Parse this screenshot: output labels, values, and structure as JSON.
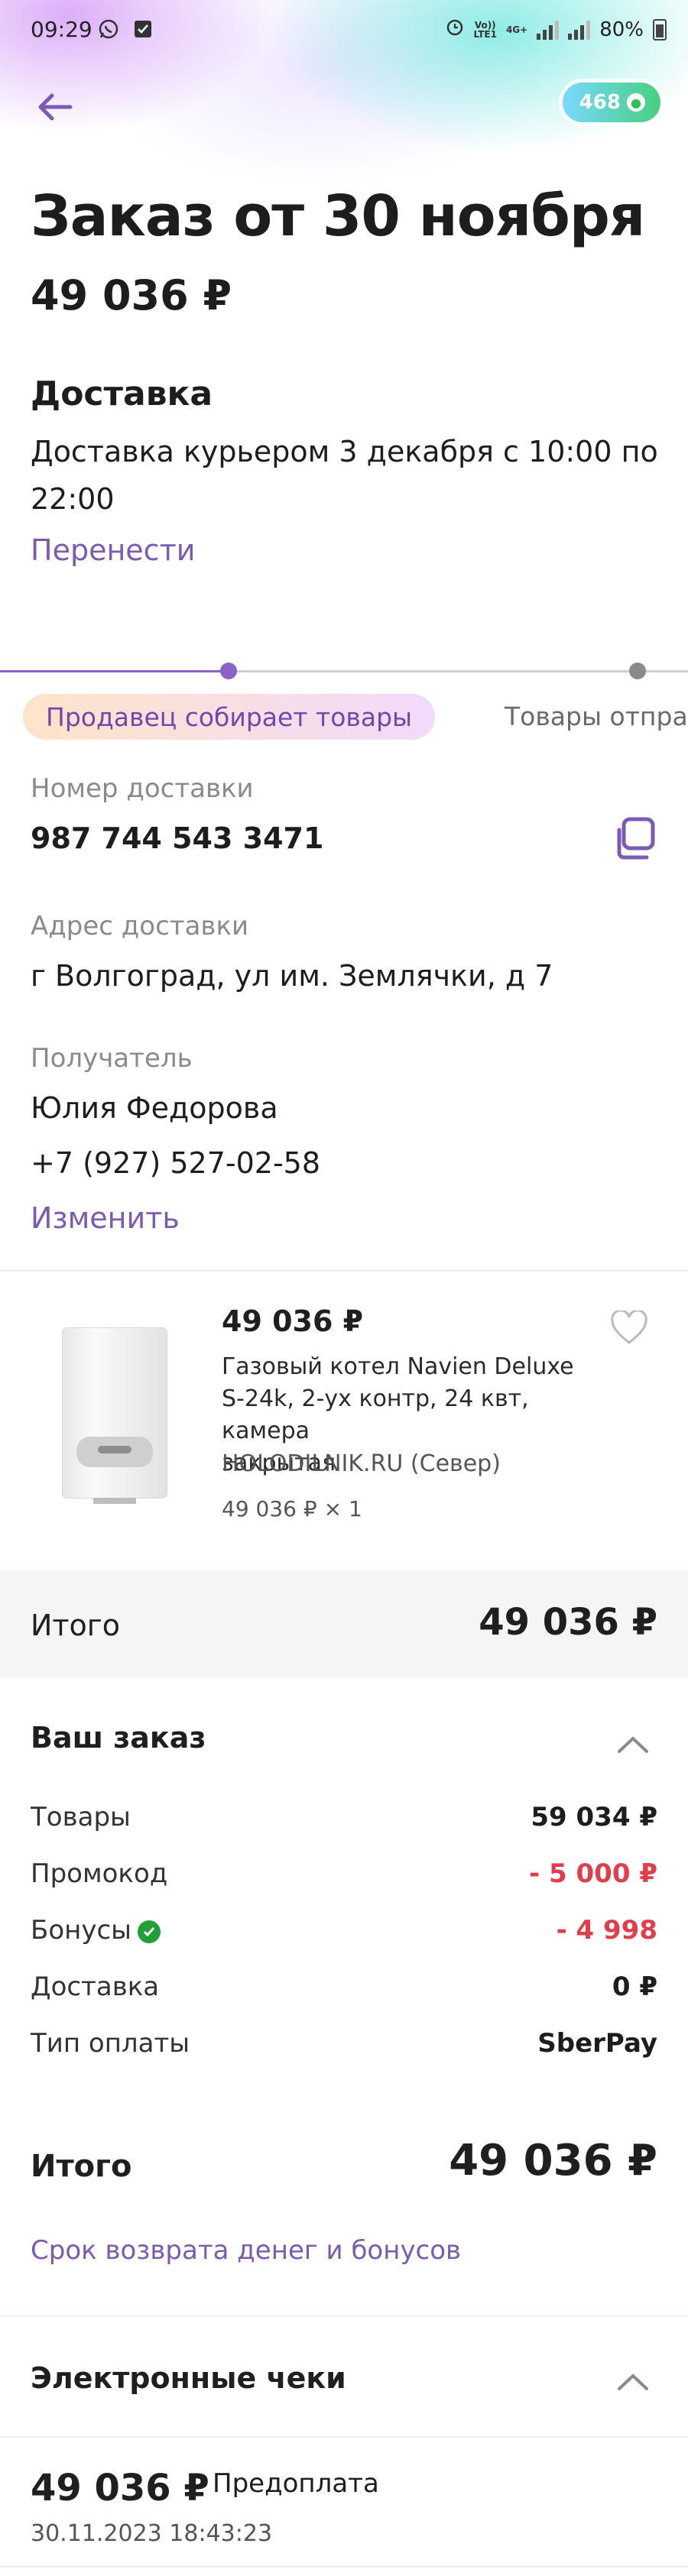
{
  "status_bar": {
    "time": "09:29",
    "net_top": "Vo))",
    "net_bottom": "LTE1",
    "net_4g": "4G+",
    "battery": "80%"
  },
  "header": {
    "bonus_count": "468",
    "title": "Заказ от 30 ноября",
    "total": "49 036 ₽"
  },
  "delivery": {
    "heading": "Доставка",
    "line1": "Доставка курьером 3 декабря с 10:00 по",
    "line2": "22:00",
    "reschedule": "Перенести"
  },
  "progress": {
    "current_step": "Продавец собирает товары",
    "next_step": "Товары отпра",
    "accent": "#8b62c6"
  },
  "details": {
    "tracking_label": "Номер доставки",
    "tracking_value": "987 744 543 3471",
    "address_label": "Адрес доставки",
    "address_value": "г Волгоград, ул им. Землячки, д 7",
    "recipient_label": "Получатель",
    "recipient_name": "Юлия Федорова",
    "recipient_phone": "+7 (927) 527-02-58",
    "change": "Изменить"
  },
  "product": {
    "price": "49 036 ₽",
    "name_line1": "Газовый котел Navien Deluxe",
    "name_line2": "S-24k, 2-ух контр, 24 квт, камера",
    "name_line3": "закрытая",
    "seller": "HOLODILNIK.RU (Север)",
    "qty": "49 036 ₽ × 1",
    "image_brand": "NAVIEN"
  },
  "itogo_band": {
    "label": "Итого",
    "value": "49 036 ₽"
  },
  "order_summary": {
    "heading": "Ваш заказ",
    "rows": [
      {
        "label": "Товары",
        "value": "59 034 ₽"
      },
      {
        "label": "Промокод",
        "value": "- 5 000 ₽"
      },
      {
        "label": "Бонусы",
        "value": "- 4 998"
      },
      {
        "label": "Доставка",
        "value": "0 ₽"
      },
      {
        "label": "Тип оплаты",
        "value": "SberPay"
      }
    ],
    "total_label": "Итого",
    "total_value": "49 036 ₽",
    "refund_link": "Срок возврата денег и бонусов"
  },
  "receipts": {
    "heading": "Электронные чеки",
    "amount": "49 036 ₽",
    "type": "Предоплата",
    "datetime": "30.11.2023 18:43:23"
  }
}
